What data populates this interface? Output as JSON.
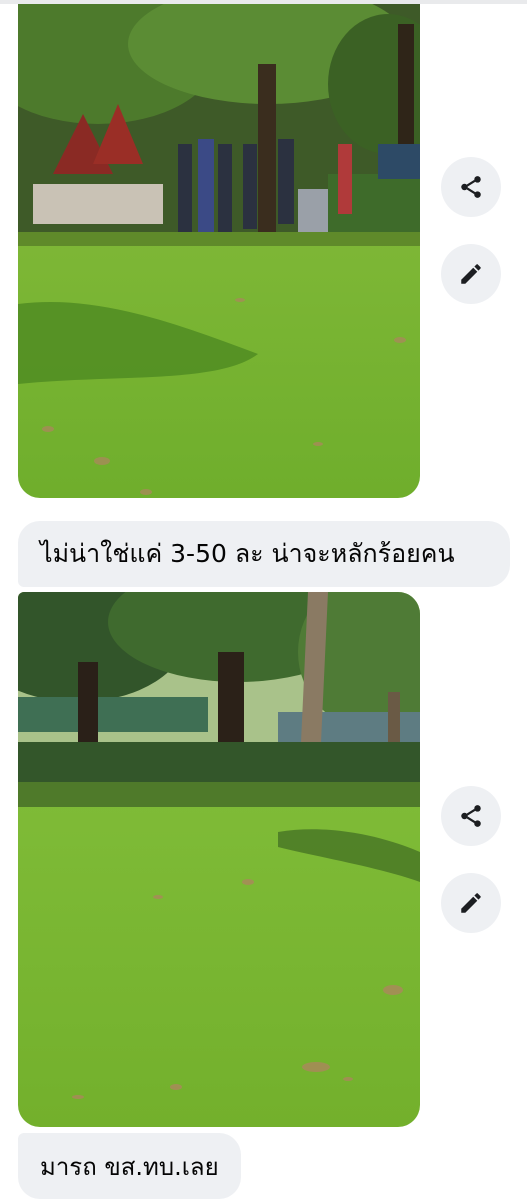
{
  "messages": [
    {
      "type": "photo",
      "description": "park-lawn-people-under-trees"
    },
    {
      "type": "text",
      "text": "ไม่น่าใช่แค่ 3-50 ละ น่าจะหลักร้อยคน"
    },
    {
      "type": "photo",
      "description": "park-lawn-buses-behind-trees"
    },
    {
      "type": "text",
      "text": "มารถ ขส.ทบ.เลย"
    }
  ],
  "actions": {
    "share_icon": "share-icon",
    "edit_icon": "pencil-icon"
  },
  "colors": {
    "bubble": "#eef0f3",
    "text": "#050505",
    "grass": "#7fb23a"
  }
}
